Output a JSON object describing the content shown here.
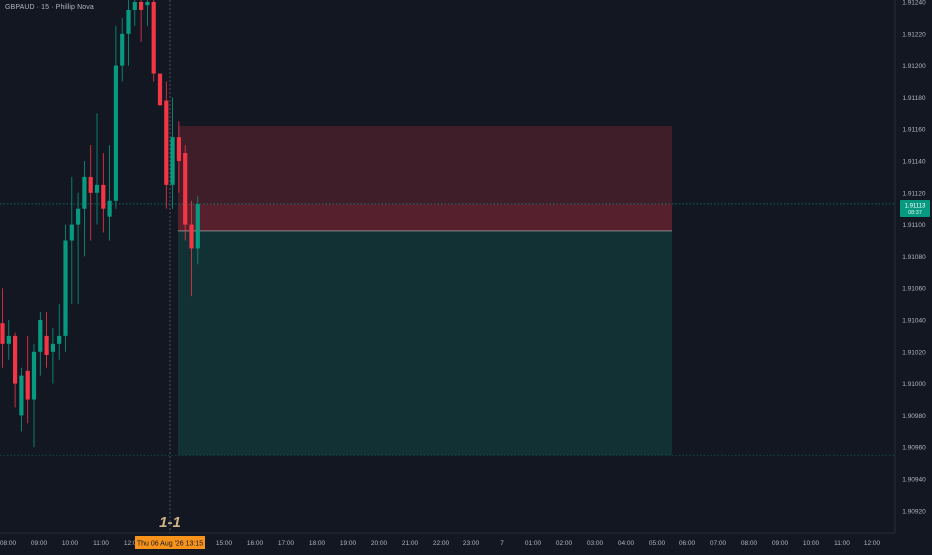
{
  "header": {
    "symbol_line": "GBPAUD · 15 · Phillip Nova"
  },
  "price_axis": {
    "ticks": [
      "1.91240",
      "1.91220",
      "1.91200",
      "1.91180",
      "1.91160",
      "1.91140",
      "1.91120",
      "1.91100",
      "1.91080",
      "1.91060",
      "1.91040",
      "1.91020",
      "1.91000",
      "1.90980",
      "1.90960",
      "1.90940",
      "1.90920"
    ],
    "current_price": "1.91113",
    "countdown": "08:37"
  },
  "time_axis": {
    "ticks": [
      "08:00",
      "09:00",
      "10:00",
      "11:00",
      "12:00",
      "15:00",
      "16:00",
      "17:00",
      "18:00",
      "19:00",
      "20:00",
      "21:00",
      "22:00",
      "23:00",
      "7",
      "01:00",
      "02:00",
      "03:00",
      "04:00",
      "05:00",
      "06:00",
      "07:00",
      "08:00",
      "09:00",
      "10:00",
      "11:00",
      "12:00"
    ],
    "crosshair_label": "Thu 06 Aug '26   13:15"
  },
  "annotation": {
    "text": "1-1"
  },
  "colors": {
    "background": "#131722",
    "bull": "#089981",
    "bear": "#f23645",
    "axis_text": "#b2b5be",
    "crosshair_label_bg": "#f7931a",
    "price_label_bg": "#089981",
    "annotation": "#d1b38a"
  },
  "chart_data": {
    "type": "candlestick",
    "title": "GBPAUD · 15 · Phillip Nova",
    "timeframe_minutes": 15,
    "y_range": [
      1.90912,
      1.91248
    ],
    "current_price": 1.91113,
    "candles": [
      {
        "o": 1.91038,
        "h": 1.9106,
        "l": 1.9101,
        "c": 1.91025
      },
      {
        "o": 1.91025,
        "h": 1.9104,
        "l": 1.91015,
        "c": 1.9103
      },
      {
        "o": 1.9103,
        "h": 1.91032,
        "l": 1.90985,
        "c": 1.91
      },
      {
        "o": 1.9098,
        "h": 1.9101,
        "l": 1.9097,
        "c": 1.91005
      },
      {
        "o": 1.91008,
        "h": 1.9103,
        "l": 1.90975,
        "c": 1.9099
      },
      {
        "o": 1.9099,
        "h": 1.91025,
        "l": 1.9096,
        "c": 1.9102
      },
      {
        "o": 1.9102,
        "h": 1.91045,
        "l": 1.91005,
        "c": 1.9104
      },
      {
        "o": 1.9103,
        "h": 1.91045,
        "l": 1.9101,
        "c": 1.91018
      },
      {
        "o": 1.9102,
        "h": 1.91035,
        "l": 1.91,
        "c": 1.91025
      },
      {
        "o": 1.91025,
        "h": 1.9105,
        "l": 1.91015,
        "c": 1.9103
      },
      {
        "o": 1.9103,
        "h": 1.911,
        "l": 1.9102,
        "c": 1.9109
      },
      {
        "o": 1.9109,
        "h": 1.9113,
        "l": 1.9105,
        "c": 1.911
      },
      {
        "o": 1.911,
        "h": 1.9112,
        "l": 1.9105,
        "c": 1.9111
      },
      {
        "o": 1.9111,
        "h": 1.9114,
        "l": 1.9108,
        "c": 1.9113
      },
      {
        "o": 1.9113,
        "h": 1.9115,
        "l": 1.9109,
        "c": 1.9112
      },
      {
        "o": 1.9112,
        "h": 1.9117,
        "l": 1.911,
        "c": 1.91125
      },
      {
        "o": 1.91125,
        "h": 1.91145,
        "l": 1.91095,
        "c": 1.9111
      },
      {
        "o": 1.91105,
        "h": 1.9115,
        "l": 1.9109,
        "c": 1.91115
      },
      {
        "o": 1.91115,
        "h": 1.91225,
        "l": 1.9111,
        "c": 1.912
      },
      {
        "o": 1.912,
        "h": 1.9123,
        "l": 1.9119,
        "c": 1.9122
      },
      {
        "o": 1.9122,
        "h": 1.91245,
        "l": 1.912,
        "c": 1.91235
      },
      {
        "o": 1.91235,
        "h": 1.91248,
        "l": 1.91225,
        "c": 1.9124
      },
      {
        "o": 1.9124,
        "h": 1.91245,
        "l": 1.91215,
        "c": 1.91235
      },
      {
        "o": 1.91238,
        "h": 1.91246,
        "l": 1.91225,
        "c": 1.9124
      },
      {
        "o": 1.9124,
        "h": 1.91245,
        "l": 1.9119,
        "c": 1.91195
      },
      {
        "o": 1.91195,
        "h": 1.91195,
        "l": 1.91175,
        "c": 1.91175
      },
      {
        "o": 1.91178,
        "h": 1.9119,
        "l": 1.9111,
        "c": 1.91125
      },
      {
        "o": 1.91125,
        "h": 1.9118,
        "l": 1.9111,
        "c": 1.91155
      },
      {
        "o": 1.91155,
        "h": 1.91165,
        "l": 1.9112,
        "c": 1.9114
      },
      {
        "o": 1.91145,
        "h": 1.9115,
        "l": 1.9109,
        "c": 1.911
      },
      {
        "o": 1.911,
        "h": 1.91115,
        "l": 1.91055,
        "c": 1.91085
      },
      {
        "o": 1.91085,
        "h": 1.91118,
        "l": 1.91075,
        "c": 1.91113
      }
    ],
    "position_tool": {
      "entry": 1.91113,
      "stop": 1.91162,
      "target": 1.90955,
      "line": 1.91096
    }
  }
}
